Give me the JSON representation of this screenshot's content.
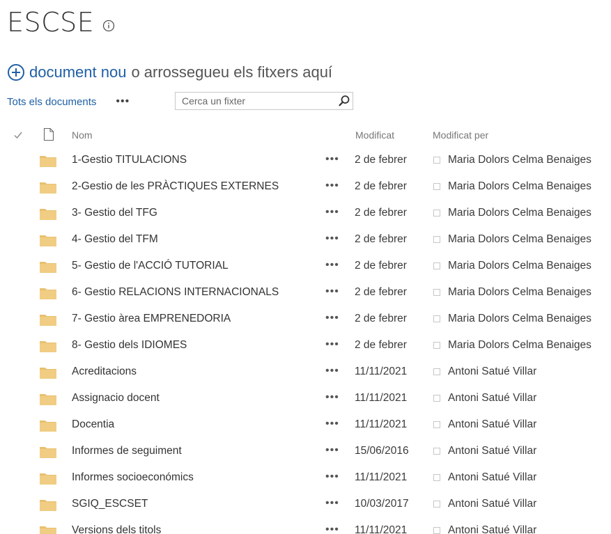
{
  "header": {
    "title": "ESCSE",
    "info_icon": "info-icon"
  },
  "new_document": {
    "link_label": "document nou",
    "rest_text": "o arrossegueu els fitxers aquí",
    "icon": "plus-circle-icon",
    "accent": "#1f5fa5"
  },
  "toolbar": {
    "view_label": "Tots els documents",
    "more_label": "•••",
    "search_placeholder": "Cerca un fixter",
    "search_icon": "search-icon"
  },
  "list": {
    "columns": {
      "name": "Nom",
      "modified": "Modificat",
      "modified_by": "Modificat per"
    },
    "more_label": "•••",
    "folder_color": "#e8c06f",
    "rows": [
      {
        "name": "1-Gestio TITULACIONS",
        "modified": "2 de febrer",
        "modified_by": "Maria Dolors Celma Benaiges"
      },
      {
        "name": "2-Gestio de les PRÀCTIQUES EXTERNES",
        "modified": "2 de febrer",
        "modified_by": "Maria Dolors Celma Benaiges"
      },
      {
        "name": "3- Gestio del TFG",
        "modified": "2 de febrer",
        "modified_by": "Maria Dolors Celma Benaiges"
      },
      {
        "name": "4- Gestio del TFM",
        "modified": "2 de febrer",
        "modified_by": "Maria Dolors Celma Benaiges"
      },
      {
        "name": "5- Gestio de l'ACCIÓ TUTORIAL",
        "modified": "2 de febrer",
        "modified_by": "Maria Dolors Celma Benaiges"
      },
      {
        "name": "6- Gestio RELACIONS INTERNACIONALS",
        "modified": "2 de febrer",
        "modified_by": "Maria Dolors Celma Benaiges"
      },
      {
        "name": "7- Gestio àrea EMPRENEDORIA",
        "modified": "2 de febrer",
        "modified_by": "Maria Dolors Celma Benaiges"
      },
      {
        "name": "8- Gestio dels IDIOMES",
        "modified": "2 de febrer",
        "modified_by": "Maria Dolors Celma Benaiges"
      },
      {
        "name": "Acreditacions",
        "modified": "11/11/2021",
        "modified_by": "Antoni Satué Villar"
      },
      {
        "name": "Assignacio docent",
        "modified": "11/11/2021",
        "modified_by": "Antoni Satué Villar"
      },
      {
        "name": "Docentia",
        "modified": "11/11/2021",
        "modified_by": "Antoni Satué Villar"
      },
      {
        "name": "Informes de seguiment",
        "modified": "15/06/2016",
        "modified_by": "Antoni Satué Villar"
      },
      {
        "name": "Informes socioeconómics",
        "modified": "11/11/2021",
        "modified_by": "Antoni Satué Villar"
      },
      {
        "name": "SGIQ_ESCSET",
        "modified": "10/03/2017",
        "modified_by": "Antoni Satué Villar"
      },
      {
        "name": "Versions dels titols",
        "modified": "11/11/2021",
        "modified_by": "Antoni Satué Villar"
      }
    ]
  }
}
